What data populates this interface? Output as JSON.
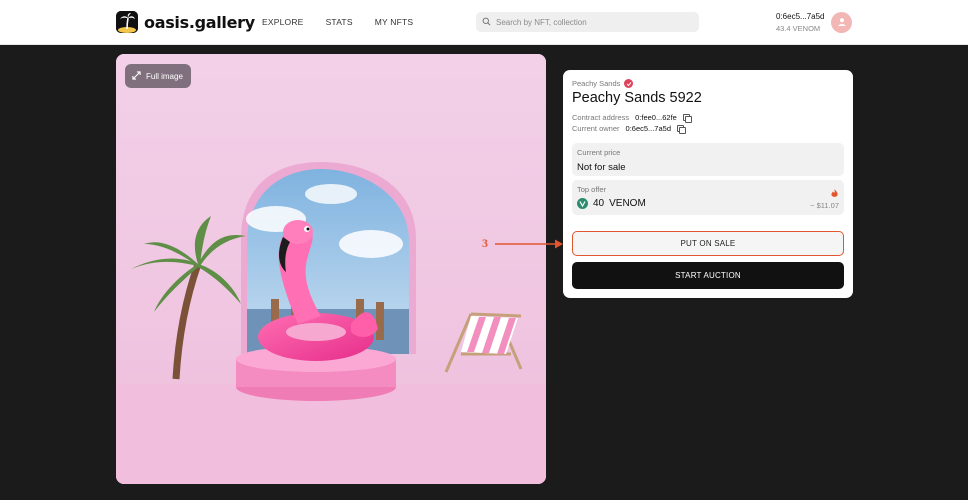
{
  "header": {
    "logo_text": "oasis.gallery",
    "nav": [
      {
        "label": "EXPLORE"
      },
      {
        "label": "STATS"
      },
      {
        "label": "MY NFTS"
      }
    ],
    "search_placeholder": "Search by NFT, collection",
    "account": {
      "address": "0:6ec5...7a5d",
      "balance": "43.4 VENOM"
    }
  },
  "image_panel": {
    "full_image_label": "Full image"
  },
  "nft": {
    "collection": "Peachy Sands",
    "title": "Peachy Sands 5922",
    "contract_label": "Contract address",
    "contract_value": "0:fee0...62fe",
    "owner_label": "Current owner",
    "owner_value": "0:6ec5...7a5d",
    "price_label": "Current price",
    "price_value": "Not for sale",
    "offer_label": "Top offer",
    "offer_amount": "40",
    "offer_currency": "VENOM",
    "offer_usd": "~ $11.07",
    "put_on_sale_label": "PUT ON SALE",
    "start_auction_label": "START AUCTION"
  },
  "annotation": {
    "number": "3",
    "color": "#e2562f"
  },
  "colors": {
    "accent": "#e2562f",
    "verified": "#e0405a",
    "image_bg": "#f0c9e2",
    "header_bg": "#ffffff",
    "page_bg": "#1b1b1b"
  },
  "icons": [
    "palm-logo-icon",
    "search-icon",
    "user-icon",
    "expand-icon",
    "verified-icon",
    "copy-icon",
    "fire-icon",
    "venom-icon",
    "arrow-icon"
  ]
}
